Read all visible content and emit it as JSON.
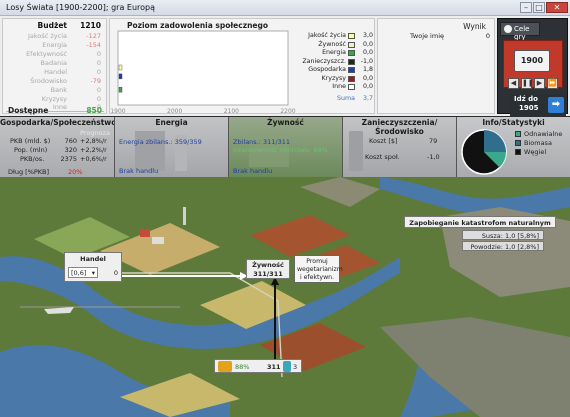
{
  "window": {
    "title": "Losy Świata [1900-2200]; gra Europą"
  },
  "budget": {
    "header": {
      "label": "Budżet",
      "value": "1210"
    },
    "rows": [
      {
        "label": "Jakość życia",
        "value": "-127"
      },
      {
        "label": "Energia",
        "value": "-154"
      },
      {
        "label": "Efektywność",
        "value": "0"
      },
      {
        "label": "Badania",
        "value": "0"
      },
      {
        "label": "Handel",
        "value": "0"
      },
      {
        "label": "Środowisko",
        "value": "-79"
      },
      {
        "label": "Bank",
        "value": "0"
      },
      {
        "label": "Kryzysy",
        "value": "0"
      },
      {
        "label": "Inne",
        "value": "0"
      }
    ],
    "available": {
      "label": "Dostępne",
      "value": "850"
    }
  },
  "chart_data": {
    "type": "line",
    "title": "Poziom zadowolenia społecznego",
    "x_ticks": [
      "1900",
      "2000",
      "2100",
      "2200"
    ],
    "xlim": [
      1900,
      2200
    ],
    "legend": [
      {
        "name": "Jakość życia",
        "value": "3,0",
        "color": "#ffff99"
      },
      {
        "name": "Żywność",
        "value": "0,0",
        "color": "#f2f2c0"
      },
      {
        "name": "Energia",
        "value": "0,0",
        "color": "#3aa83a"
      },
      {
        "name": "Zanieczyszcz.",
        "value": "-1,0",
        "color": "#1b2a1b"
      },
      {
        "name": "Gospodarka",
        "value": "1,8",
        "color": "#1c3fb5"
      },
      {
        "name": "Kryzysy",
        "value": "0,0",
        "color": "#a01818"
      },
      {
        "name": "Inne",
        "value": "0,0",
        "color": "#ffffff"
      }
    ],
    "sum": {
      "label": "Suma",
      "value": "3,7"
    },
    "series": [
      {
        "name": "Jakość życia",
        "x": [
          1900
        ],
        "y": [
          3.0
        ],
        "color": "#ffff99"
      },
      {
        "name": "Energia",
        "x": [
          1900
        ],
        "y": [
          0.0
        ],
        "color": "#3aa83a"
      },
      {
        "name": "Gospodarka",
        "x": [
          1900
        ],
        "y": [
          1.8
        ],
        "color": "#1c3fb5"
      }
    ]
  },
  "score": {
    "title": "Wynik",
    "name": "Twoje imię",
    "value": "0"
  },
  "controls": {
    "goals_label": "Cele gry",
    "year": "1900",
    "goto_line1": "Idź do",
    "goto_line2": "1905",
    "goto_arrow": "➡"
  },
  "categories": {
    "economy": {
      "title": "Gospodarka/Społeczeństwo",
      "forecast": "Prognoza",
      "rows": [
        {
          "label": "PKB (mld. $)",
          "value": "760",
          "change": "+2,8%/r"
        },
        {
          "label": "Pop. (mln)",
          "value": "320",
          "change": "+2,2%/r"
        },
        {
          "label": "PKB/os.",
          "value": "2375",
          "change": "+0,6%/r"
        }
      ],
      "debt_label": "Dług [%PKB]",
      "debt_value": "20%"
    },
    "energy": {
      "title": "Energia",
      "balance": "Energia zbilans.: 359/359",
      "trade": "Brak handlu"
    },
    "food": {
      "title": "Żywność",
      "balance": "Zbilans.: 311/311",
      "efficiency": "Intensywność rolnictwa: 88%",
      "trade": "Brak handlu"
    },
    "pollution": {
      "title": "Zanieczyszczenia/Środowisko",
      "cost_label": "Koszt [$]",
      "cost_value": "79",
      "social_label": "Koszt społ.",
      "social_value": "-1,0"
    },
    "info": {
      "title": "Info/Statystyki",
      "legend": [
        {
          "name": "Odnawialne",
          "color": "#3aa88a"
        },
        {
          "name": "Biomasa",
          "color": "#2f6e8c"
        },
        {
          "name": "Węgiel",
          "color": "#111111"
        }
      ]
    }
  },
  "map": {
    "trade_box": {
      "title": "Handel",
      "select": "[0,6]",
      "value": "0"
    },
    "food_box": {
      "title": "Żywność",
      "value": "311/311"
    },
    "promo_btn": "Promuj wegetarianizm i efektywn.",
    "disaster": {
      "title": "Zapobieganie katastrofom naturalnym",
      "drought": "Susza: 1,0  [5,8%]",
      "flood": "Powodzie: 1,0  [2,8%]"
    },
    "farm_bar": {
      "pct": "88%",
      "value": "311",
      "research": "3"
    }
  }
}
